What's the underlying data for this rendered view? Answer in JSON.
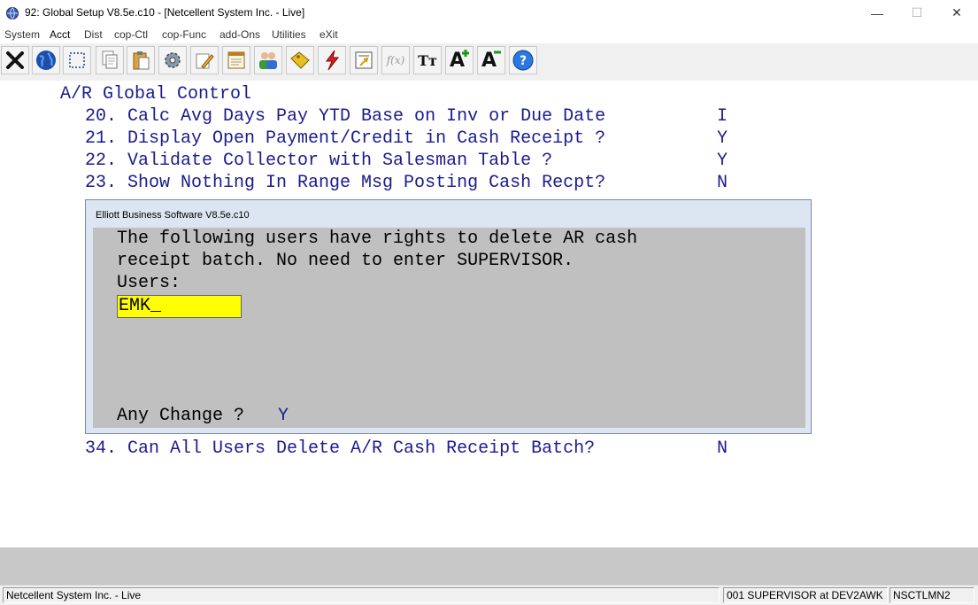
{
  "window": {
    "title": "92: Global Setup V8.5e.c10 - [Netcellent System Inc. - Live]",
    "minimize": "—",
    "maximize": "☐",
    "close": "✕"
  },
  "menu": [
    "System",
    "Acct",
    "Dist",
    "cop-Ctl",
    "cop-Func",
    "add-Ons",
    "Utilities",
    "eXit"
  ],
  "toolbar": {
    "icons": [
      "exit-icon",
      "globe-icon",
      "select-icon",
      "copy-icon",
      "paste-icon",
      "settings-icon",
      "edit-icon",
      "notepad-icon",
      "users-icon",
      "tag-icon",
      "lightning-icon",
      "calculator-icon",
      "function-icon",
      "font-type-icon",
      "font-larger-icon",
      "font-smaller-icon",
      "help-icon"
    ],
    "function_label": "f(x)",
    "font_type_label": "Tт",
    "font_larger_label": "A",
    "font_smaller_label": "A"
  },
  "screen": {
    "heading": "A/R Global Control",
    "lines": [
      {
        "text": "20. Calc Avg Days Pay YTD Base on Inv or Due Date",
        "value": "I"
      },
      {
        "text": "21. Display Open Payment/Credit in Cash Receipt ?",
        "value": "Y"
      },
      {
        "text": "22. Validate Collector with Salesman Table ?",
        "value": "Y"
      },
      {
        "text": "23. Show Nothing In Range Msg Posting Cash Recpt?",
        "value": "N"
      }
    ],
    "line34": {
      "text": "34. Can All Users Delete A/R Cash Receipt Batch?",
      "value": "N"
    }
  },
  "dialog": {
    "title": "Elliott Business Software V8.5e.c10",
    "line1": "The following users have rights to delete AR cash",
    "line2": "receipt batch. No need to enter SUPERVISOR.",
    "users_label": "Users:",
    "users_value": "EMK_",
    "any_change_label": "Any Change ? ",
    "any_change_value": "Y"
  },
  "status": {
    "company": "Netcellent System Inc. - Live",
    "user": "001 SUPERVISOR at DEV2AWK",
    "machine": "NSCTLMN2"
  },
  "colors": {
    "screen_text": "#1b1b8c",
    "input_bg": "#ffff00",
    "dialog_body": "#c0c0c0"
  }
}
